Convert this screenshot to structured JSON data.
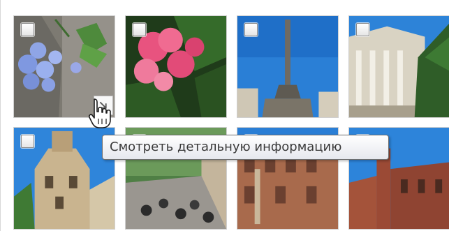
{
  "gallery": {
    "items": [
      {
        "name": "blue-flowers",
        "selected": false
      },
      {
        "name": "pink-flowers",
        "selected": false
      },
      {
        "name": "columbus-monument",
        "selected": false
      },
      {
        "name": "classical-building",
        "selected": false
      },
      {
        "name": "castle-tower",
        "selected": false
      },
      {
        "name": "street-scooters",
        "selected": false
      },
      {
        "name": "brick-building",
        "selected": false
      },
      {
        "name": "red-tower",
        "selected": false
      }
    ]
  },
  "tooltip": {
    "text": "Смотреть детальную информацию"
  },
  "icons": {
    "detail": "expand-arrow-icon",
    "cursor": "hand-pointer-icon"
  }
}
